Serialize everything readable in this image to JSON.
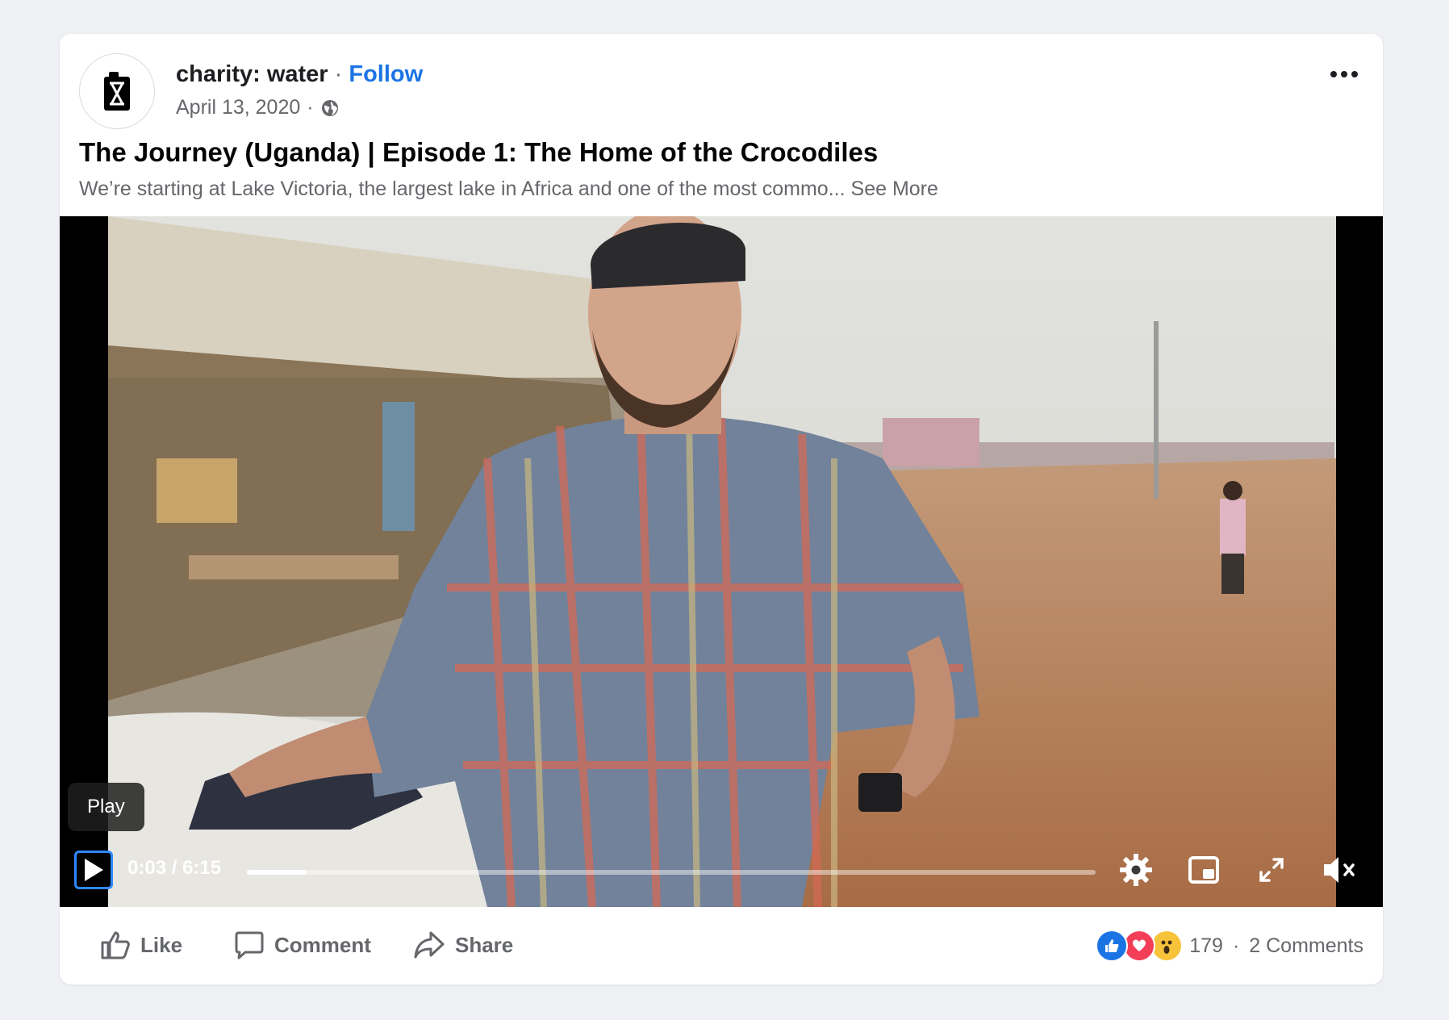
{
  "post": {
    "page_name": "charity: water",
    "separator": "·",
    "follow_label": "Follow",
    "date": "April 13, 2020",
    "date_separator": "·",
    "title": "The Journey (Uganda) | Episode 1: The Home of the Crocodiles",
    "description": "We’re starting at Lake Victoria, the largest lake in Africa and one of the most commo...",
    "see_more_label": "See More"
  },
  "video": {
    "tooltip": "Play",
    "time": "0:03 / 6:15",
    "progress_fraction": 0.07,
    "controls": [
      "settings-icon",
      "picture-in-picture-icon",
      "fullscreen-icon",
      "mute-icon"
    ]
  },
  "actions": {
    "like_label": "Like",
    "comment_label": "Comment",
    "share_label": "Share",
    "reaction_count": "179",
    "dot": "·",
    "comments_label": "2 Comments"
  },
  "colors": {
    "accent": "#1b74e4",
    "focus": "#2d88ff",
    "muted_text": "#65676b"
  }
}
